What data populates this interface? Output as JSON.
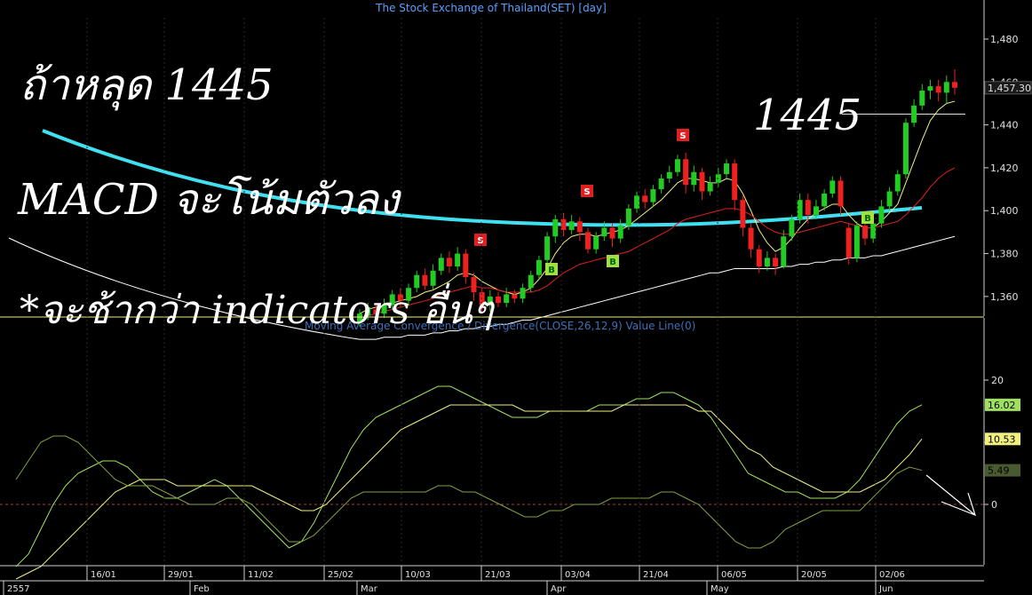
{
  "chart_data": [
    {
      "type": "candlestick",
      "title": "The Stock Exchange of Thailand(SET) [day]",
      "ylim": [
        1340,
        1490
      ],
      "y_ticks": [
        1360,
        1380,
        1400,
        1420,
        1440,
        1460,
        1480
      ],
      "y_tick_labels": [
        "1,360",
        "1,380",
        "1,400",
        "1,420",
        "1,440",
        "1,460",
        "1,480"
      ],
      "last_price_label": "1,457.30",
      "reference_line": 1445,
      "candles": [
        {
          "o": 1348,
          "c": 1352,
          "h": 1354,
          "l": 1346
        },
        {
          "o": 1351,
          "c": 1355,
          "h": 1357,
          "l": 1349
        },
        {
          "o": 1354,
          "c": 1352,
          "h": 1357,
          "l": 1349
        },
        {
          "o": 1352,
          "c": 1356,
          "h": 1359,
          "l": 1350
        },
        {
          "o": 1356,
          "c": 1361,
          "h": 1363,
          "l": 1354
        },
        {
          "o": 1361,
          "c": 1358,
          "h": 1364,
          "l": 1355
        },
        {
          "o": 1358,
          "c": 1364,
          "h": 1366,
          "l": 1356
        },
        {
          "o": 1364,
          "c": 1370,
          "h": 1372,
          "l": 1362
        },
        {
          "o": 1370,
          "c": 1365,
          "h": 1373,
          "l": 1363
        },
        {
          "o": 1365,
          "c": 1372,
          "h": 1375,
          "l": 1363
        },
        {
          "o": 1372,
          "c": 1378,
          "h": 1380,
          "l": 1370
        },
        {
          "o": 1378,
          "c": 1374,
          "h": 1381,
          "l": 1371
        },
        {
          "o": 1374,
          "c": 1380,
          "h": 1383,
          "l": 1372
        },
        {
          "o": 1380,
          "c": 1369,
          "h": 1382,
          "l": 1366
        },
        {
          "o": 1369,
          "c": 1362,
          "h": 1371,
          "l": 1358
        },
        {
          "o": 1362,
          "c": 1356,
          "h": 1364,
          "l": 1352
        },
        {
          "o": 1356,
          "c": 1360,
          "h": 1363,
          "l": 1353
        },
        {
          "o": 1360,
          "c": 1357,
          "h": 1362,
          "l": 1355
        },
        {
          "o": 1357,
          "c": 1361,
          "h": 1364,
          "l": 1355
        },
        {
          "o": 1361,
          "c": 1359,
          "h": 1363,
          "l": 1357
        },
        {
          "o": 1359,
          "c": 1364,
          "h": 1366,
          "l": 1357
        },
        {
          "o": 1364,
          "c": 1370,
          "h": 1372,
          "l": 1362
        },
        {
          "o": 1370,
          "c": 1377,
          "h": 1379,
          "l": 1368
        },
        {
          "o": 1377,
          "c": 1388,
          "h": 1390,
          "l": 1375
        },
        {
          "o": 1388,
          "c": 1396,
          "h": 1398,
          "l": 1385
        },
        {
          "o": 1396,
          "c": 1391,
          "h": 1399,
          "l": 1388
        },
        {
          "o": 1391,
          "c": 1395,
          "h": 1398,
          "l": 1389
        },
        {
          "o": 1395,
          "c": 1390,
          "h": 1397,
          "l": 1386
        },
        {
          "o": 1390,
          "c": 1382,
          "h": 1392,
          "l": 1380
        },
        {
          "o": 1382,
          "c": 1388,
          "h": 1390,
          "l": 1380
        },
        {
          "o": 1388,
          "c": 1392,
          "h": 1395,
          "l": 1386
        },
        {
          "o": 1392,
          "c": 1387,
          "h": 1394,
          "l": 1383
        },
        {
          "o": 1387,
          "c": 1393,
          "h": 1396,
          "l": 1385
        },
        {
          "o": 1393,
          "c": 1401,
          "h": 1403,
          "l": 1391
        },
        {
          "o": 1401,
          "c": 1407,
          "h": 1409,
          "l": 1399
        },
        {
          "o": 1407,
          "c": 1404,
          "h": 1410,
          "l": 1401
        },
        {
          "o": 1404,
          "c": 1410,
          "h": 1412,
          "l": 1402
        },
        {
          "o": 1410,
          "c": 1415,
          "h": 1417,
          "l": 1408
        },
        {
          "o": 1415,
          "c": 1418,
          "h": 1421,
          "l": 1413
        },
        {
          "o": 1418,
          "c": 1424,
          "h": 1426,
          "l": 1416
        },
        {
          "o": 1424,
          "c": 1412,
          "h": 1427,
          "l": 1408
        },
        {
          "o": 1412,
          "c": 1418,
          "h": 1421,
          "l": 1409
        },
        {
          "o": 1418,
          "c": 1409,
          "h": 1420,
          "l": 1405
        },
        {
          "o": 1409,
          "c": 1413,
          "h": 1416,
          "l": 1407
        },
        {
          "o": 1413,
          "c": 1417,
          "h": 1420,
          "l": 1411
        },
        {
          "o": 1417,
          "c": 1422,
          "h": 1424,
          "l": 1415
        },
        {
          "o": 1422,
          "c": 1405,
          "h": 1424,
          "l": 1400
        },
        {
          "o": 1405,
          "c": 1392,
          "h": 1407,
          "l": 1388
        },
        {
          "o": 1392,
          "c": 1382,
          "h": 1394,
          "l": 1378
        },
        {
          "o": 1382,
          "c": 1374,
          "h": 1384,
          "l": 1371
        },
        {
          "o": 1374,
          "c": 1378,
          "h": 1381,
          "l": 1372
        },
        {
          "o": 1378,
          "c": 1374,
          "h": 1380,
          "l": 1370
        },
        {
          "o": 1374,
          "c": 1388,
          "h": 1391,
          "l": 1373
        },
        {
          "o": 1388,
          "c": 1396,
          "h": 1398,
          "l": 1386
        },
        {
          "o": 1396,
          "c": 1405,
          "h": 1408,
          "l": 1394
        },
        {
          "o": 1405,
          "c": 1398,
          "h": 1408,
          "l": 1394
        },
        {
          "o": 1398,
          "c": 1402,
          "h": 1405,
          "l": 1396
        },
        {
          "o": 1402,
          "c": 1408,
          "h": 1410,
          "l": 1400
        },
        {
          "o": 1408,
          "c": 1414,
          "h": 1416,
          "l": 1406
        },
        {
          "o": 1414,
          "c": 1402,
          "h": 1416,
          "l": 1398
        },
        {
          "o": 1392,
          "c": 1378,
          "h": 1394,
          "l": 1375
        },
        {
          "o": 1378,
          "c": 1393,
          "h": 1395,
          "l": 1376
        },
        {
          "o": 1393,
          "c": 1387,
          "h": 1396,
          "l": 1384
        },
        {
          "o": 1387,
          "c": 1394,
          "h": 1397,
          "l": 1385
        },
        {
          "o": 1394,
          "c": 1402,
          "h": 1405,
          "l": 1392
        },
        {
          "o": 1402,
          "c": 1409,
          "h": 1411,
          "l": 1400
        },
        {
          "o": 1409,
          "c": 1417,
          "h": 1419,
          "l": 1407
        },
        {
          "o": 1417,
          "c": 1441,
          "h": 1443,
          "l": 1415
        },
        {
          "o": 1441,
          "c": 1449,
          "h": 1452,
          "l": 1439
        },
        {
          "o": 1449,
          "c": 1456,
          "h": 1459,
          "l": 1447
        },
        {
          "o": 1456,
          "c": 1458,
          "h": 1461,
          "l": 1452
        },
        {
          "o": 1458,
          "c": 1455,
          "h": 1461,
          "l": 1451
        },
        {
          "o": 1455,
          "c": 1460,
          "h": 1463,
          "l": 1450
        },
        {
          "o": 1460,
          "c": 1457.3,
          "h": 1466,
          "l": 1454
        }
      ],
      "series": [
        {
          "name": "",
          "values": [
            1352,
            1354,
            1355,
            1356,
            1357,
            1358,
            1359,
            1360,
            1362,
            1363,
            1365,
            1367,
            1370,
            1371,
            1370,
            1367,
            1365,
            1363,
            1362,
            1361,
            1362,
            1364,
            1368,
            1373,
            1380,
            1385,
            1388,
            1389,
            1389,
            1388,
            1389,
            1390,
            1391,
            1393,
            1396,
            1399,
            1402,
            1405,
            1409,
            1413,
            1415,
            1415,
            1414,
            1413,
            1413,
            1415,
            1414,
            1408,
            1400,
            1391,
            1385,
            1381,
            1383,
            1387,
            1392,
            1396,
            1399,
            1401,
            1403,
            1403,
            1398,
            1394,
            1392,
            1392,
            1395,
            1399,
            1403,
            1413,
            1423,
            1433,
            1442,
            1447,
            1450,
            1451
          ],
          "color": "#f0f080"
        },
        {
          "name": "",
          "values": [
            1350,
            1351,
            1352,
            1353,
            1354,
            1355,
            1356,
            1357,
            1358,
            1359,
            1361,
            1362,
            1363,
            1364,
            1365,
            1364,
            1364,
            1363,
            1362,
            1362,
            1362,
            1362,
            1363,
            1365,
            1368,
            1371,
            1373,
            1375,
            1376,
            1377,
            1378,
            1379,
            1380,
            1381,
            1383,
            1385,
            1387,
            1389,
            1391,
            1394,
            1396,
            1397,
            1398,
            1399,
            1400,
            1401,
            1401,
            1400,
            1398,
            1395,
            1392,
            1390,
            1389,
            1389,
            1390,
            1391,
            1392,
            1393,
            1394,
            1395,
            1394,
            1393,
            1392,
            1392,
            1393,
            1394,
            1395,
            1398,
            1402,
            1406,
            1411,
            1415,
            1418,
            1420
          ],
          "color": "#e02020"
        },
        {
          "name": "",
          "values": [
            1340,
            1340,
            1340,
            1341,
            1341,
            1341,
            1342,
            1342,
            1342,
            1343,
            1343,
            1344,
            1344,
            1345,
            1345,
            1346,
            1346,
            1347,
            1347,
            1348,
            1349,
            1349,
            1350,
            1351,
            1352,
            1353,
            1354,
            1355,
            1356,
            1357,
            1358,
            1359,
            1360,
            1361,
            1362,
            1363,
            1364,
            1365,
            1366,
            1367,
            1368,
            1369,
            1370,
            1371,
            1371,
            1372,
            1373,
            1373,
            1373,
            1373,
            1373,
            1373,
            1374,
            1374,
            1375,
            1375,
            1376,
            1376,
            1377,
            1377,
            1378,
            1378,
            1378,
            1379,
            1379,
            1380,
            1381,
            1382,
            1383,
            1384,
            1385,
            1386,
            1387,
            1388
          ],
          "color": "#ffffff"
        }
      ],
      "signals": [
        {
          "label": "S",
          "index": 21
        },
        {
          "label": "B",
          "index": 34
        },
        {
          "label": "S",
          "index": 42
        },
        {
          "label": "B",
          "index": 46
        },
        {
          "label": "S",
          "index": 62
        },
        {
          "label": "B",
          "index": 102
        }
      ]
    },
    {
      "type": "line",
      "title": "Moving Average Convergence / Divergence(CLOSE,26,12,9) Value Line(0)",
      "ylim": [
        -10,
        25
      ],
      "y_ticks": [
        20,
        10,
        0
      ],
      "y_tick_labels": [
        "20",
        "",
        "0"
      ],
      "value_labels": [
        "16.02",
        "10.53",
        "5.49"
      ],
      "series": [
        {
          "name": "",
          "values": [
            -10,
            -8,
            -4,
            0,
            3,
            5,
            6,
            7,
            7,
            6,
            4,
            2,
            1,
            1,
            2,
            3,
            4,
            3,
            1,
            -1,
            -3,
            -5,
            -7,
            -6,
            -3,
            1,
            5,
            9,
            12,
            14,
            15,
            16,
            17,
            18,
            19,
            19,
            18,
            17,
            16,
            15,
            14,
            14,
            14,
            15,
            15,
            15,
            15,
            16,
            16,
            16,
            17,
            17,
            18,
            18,
            17,
            16,
            14,
            11,
            8,
            5,
            4,
            3,
            2,
            2,
            1,
            1,
            1,
            2,
            4,
            7,
            10,
            13,
            15,
            16.02
          ],
          "color": "#a0e060"
        },
        {
          "name": "",
          "values": [
            -12,
            -11,
            -10,
            -8,
            -6,
            -4,
            -2,
            0,
            2,
            3,
            4,
            4,
            4,
            3,
            3,
            3,
            3,
            3,
            3,
            3,
            2,
            1,
            0,
            -1,
            -1,
            0,
            2,
            4,
            6,
            8,
            10,
            12,
            13,
            14,
            15,
            16,
            16,
            16,
            16,
            16,
            16,
            15,
            15,
            15,
            15,
            15,
            15,
            15,
            15,
            16,
            16,
            16,
            16,
            16,
            16,
            15,
            15,
            13,
            11,
            9,
            8,
            6,
            5,
            4,
            3,
            2,
            2,
            2,
            2,
            3,
            4,
            6,
            8,
            10.53
          ],
          "color": "#f0f080"
        },
        {
          "name": "",
          "values": [
            4,
            7,
            10,
            11,
            11,
            10,
            8,
            6,
            4,
            3,
            3,
            3,
            2,
            1,
            0,
            0,
            0,
            1,
            1,
            0,
            -2,
            -4,
            -6,
            -6,
            -5,
            -3,
            -1,
            1,
            2,
            2,
            2,
            2,
            2,
            2,
            3,
            3,
            2,
            2,
            1,
            0,
            -1,
            -2,
            -2,
            -1,
            -1,
            0,
            0,
            0,
            1,
            1,
            1,
            1,
            2,
            2,
            1,
            0,
            -2,
            -4,
            -6,
            -7,
            -7,
            -6,
            -4,
            -3,
            -2,
            -1,
            -1,
            -1,
            -1,
            1,
            3,
            5,
            6,
            5.49
          ],
          "color": "#80a040"
        }
      ],
      "zero_line": 0
    }
  ],
  "x_axis": {
    "upper_labels": [
      "16/01",
      "29/01",
      "11/02",
      "25/02",
      "10/03",
      "21/03",
      "03/04",
      "21/04",
      "06/05",
      "20/05",
      "02/06"
    ],
    "lower_labels": [
      "2557",
      "Feb",
      "Mar",
      "Apr",
      "May",
      "Jun"
    ]
  },
  "annotations": {
    "line1": "ถ้าหลุด 1445",
    "line2": "MACD จะโน้มตัวลง",
    "line3": "*จะช้ากว่า indicators อื่นๆ",
    "level_label": "1445"
  },
  "colors": {
    "up": "#22cc22",
    "down": "#ee2020",
    "ma_cyan": "#40e0f0",
    "sell_badge": "#e02020",
    "buy_badge": "#a0e040"
  }
}
